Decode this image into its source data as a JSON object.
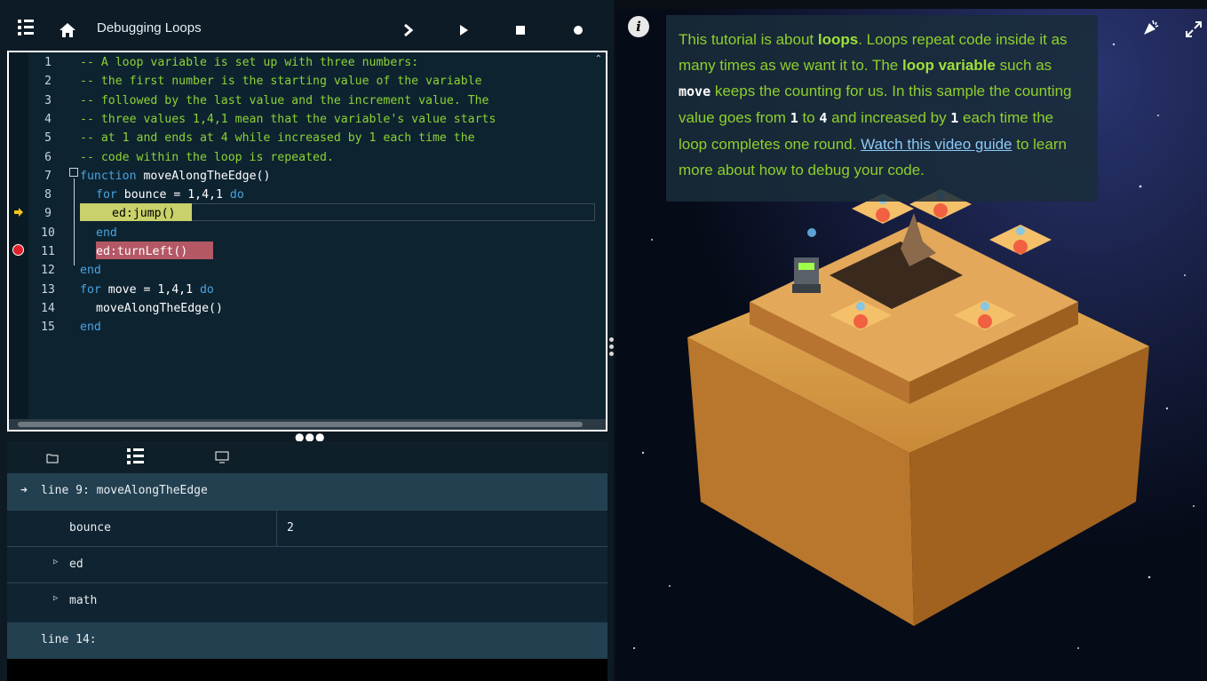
{
  "window": {
    "title": "Debugging Loops"
  },
  "editor": {
    "lines": [
      {
        "n": "1",
        "text": "-- A loop variable is set up with three numbers:"
      },
      {
        "n": "2",
        "text": "-- the first number is the starting value of the variable"
      },
      {
        "n": "3",
        "text": "-- followed by the last value and the increment value. The"
      },
      {
        "n": "4",
        "text": "-- three values 1,4,1 mean that the variable's value starts"
      },
      {
        "n": "5",
        "text": "-- at 1 and ends at 4 while increased by 1 each time the"
      },
      {
        "n": "6",
        "text": "-- code within the loop is repeated."
      },
      {
        "n": "7",
        "kw": "function",
        "rest": " moveAlongTheEdge()"
      },
      {
        "n": "8",
        "kw": "for",
        "rest": " bounce = 1,4,1 ",
        "kw2": "do"
      },
      {
        "n": "9",
        "text": "ed:jump()"
      },
      {
        "n": "10",
        "kw": "end"
      },
      {
        "n": "11",
        "text": "ed:turnLeft()"
      },
      {
        "n": "12",
        "kw": "end"
      },
      {
        "n": "13",
        "kw": "for",
        "rest": " move = 1,4,1 ",
        "kw2": "do"
      },
      {
        "n": "14",
        "text": "moveAlongTheEdge()"
      },
      {
        "n": "15",
        "kw": "end"
      }
    ]
  },
  "debugger": {
    "frame1": "line 9: moveAlongTheEdge",
    "vars": [
      {
        "name": "bounce",
        "value": "2"
      },
      {
        "name": "ed"
      },
      {
        "name": "math"
      }
    ],
    "frame2": "line 14:"
  },
  "info": {
    "p1": "This tutorial is about ",
    "b1": "loops",
    "p2": ". Loops repeat code inside it as many times as we want it to. The ",
    "b2": "loop variable",
    "p3": " such as ",
    "m1": "move",
    "p4": " keeps the counting for us. In this sample the counting value goes from ",
    "m2": "1",
    "p5": " to ",
    "m3": "4",
    "p6": " and increased by ",
    "m4": "1",
    "p7": " each time the loop completes one round. ",
    "link": "Watch this video guide",
    "p8": " to learn more about how to debug your code."
  },
  "colors": {
    "comment": "#8dd234",
    "keyword": "#4aa3e0",
    "current_line": "#c8d16a",
    "breakpoint": "#e0202a"
  }
}
